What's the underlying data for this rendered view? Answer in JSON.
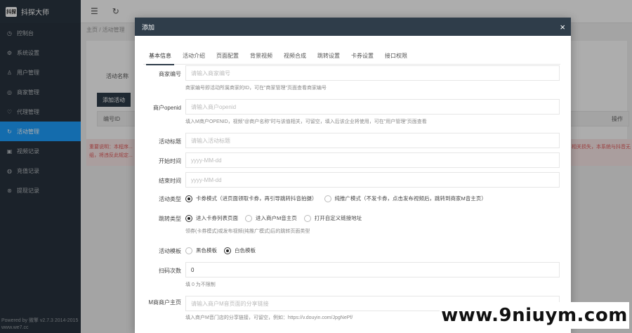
{
  "brand": {
    "logo_text": "抖探",
    "name": "抖探大师"
  },
  "sidebar": {
    "items": [
      {
        "icon": "dashboard-icon",
        "glyph": "◷",
        "label": "控制台"
      },
      {
        "icon": "gear-icon",
        "glyph": "⚙",
        "label": "系统设置"
      },
      {
        "icon": "user-icon",
        "glyph": "♙",
        "label": "用户管理"
      },
      {
        "icon": "merchant-icon",
        "glyph": "◎",
        "label": "商家管理"
      },
      {
        "icon": "agent-icon",
        "glyph": "♡",
        "label": "代理管理"
      },
      {
        "icon": "activity-icon",
        "glyph": "↻",
        "label": "活动管理"
      },
      {
        "icon": "video-icon",
        "glyph": "▣",
        "label": "视频记录"
      },
      {
        "icon": "recharge-icon",
        "glyph": "◍",
        "label": "充值记录"
      },
      {
        "icon": "withdraw-icon",
        "glyph": "⊛",
        "label": "提现记录"
      }
    ],
    "footer_line1": "Powered by 微擎 v2.7.3 2014-2015",
    "footer_line2": "www.we7.cc"
  },
  "topbar": {
    "menu_glyph": "☰",
    "refresh_glyph": "↻"
  },
  "background": {
    "breadcrumb": "主页 / 活动管理",
    "search_label": "活动名称",
    "add_button": "添加活动",
    "col_id": "编号ID",
    "col_action": "操作",
    "notice_line1": "重要说明：本程序...",
    "notice_line2": "组，将违反此规定...",
    "notice_right": "相关损失，本系统与抖音无"
  },
  "modal": {
    "title": "添加",
    "close_glyph": "×",
    "tabs": [
      "基本信息",
      "活动介绍",
      "页面配置",
      "背景视频",
      "视频合成",
      "跳转设置",
      "卡券设置",
      "接口权限"
    ],
    "fields": {
      "merchant_no": {
        "label": "商家编号",
        "placeholder": "请输入商家编号",
        "hint": "商家编号即活动所属商家的ID，可在\"商家管理\"页面查看商家编号"
      },
      "openid": {
        "label": "商户openid",
        "placeholder": "请输入商户openid",
        "hint": "填入M商户OPENID，视频\"@商户名称\"时与该值相关，可留空，填入后该企业将使用，可在\"用户管理\"页面查看"
      },
      "title": {
        "label": "活动标题",
        "placeholder": "请输入活动标题"
      },
      "start_time": {
        "label": "开始时间",
        "placeholder": "yyyy-MM-dd"
      },
      "end_time": {
        "label": "结束时间",
        "placeholder": "yyyy-MM-dd"
      },
      "type": {
        "label": "活动类型",
        "options": [
          "卡券模式（进页面领取卡券，再引导跳转抖音拍摄）",
          "纯推广模式（不发卡券，点击发布视频后，跳转到商家M音主页）"
        ]
      },
      "jump": {
        "label": "跳转类型",
        "options": [
          "进入卡券列表页面",
          "进入商户M音主页",
          "打开自定义链接地址"
        ],
        "hint": "领券(卡券模式)或发布视频(纯推广模式)后的跳转页面类型"
      },
      "template": {
        "label": "活动模板",
        "options": [
          "黑色模板",
          "白色模板"
        ]
      },
      "share_count": {
        "label": "扫码次数",
        "value": "0",
        "hint": "填 0 为不限制"
      },
      "share_link": {
        "label": "M商商户主页",
        "placeholder": "请输入商户M音页面的分享链接",
        "hint": "填入商户M音门店的分享链接，可留空，例如：https://v.douyin.com/JpgNePf/"
      }
    }
  },
  "watermark": "www.9niuym.com"
}
